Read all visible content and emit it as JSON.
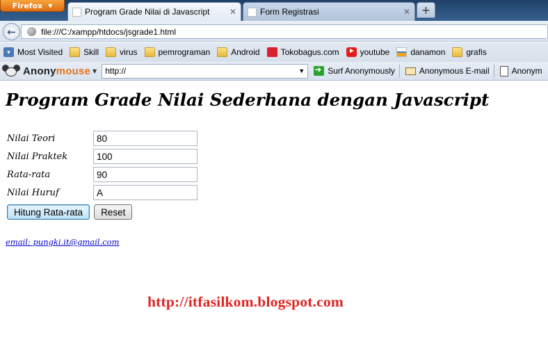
{
  "browser": {
    "menu_button": "Firefox",
    "tabs": [
      {
        "title": "Program Grade Nilai di Javascript",
        "active": true
      },
      {
        "title": "Form Registrasi",
        "active": false
      }
    ],
    "new_tab_label": "+",
    "close_glyph": "✕",
    "url": "file:///C:/xampp/htdocs/jsgrade1.html"
  },
  "bookmarks": [
    {
      "label": "Most Visited",
      "icon": "most-visited-icon"
    },
    {
      "label": "Skill",
      "icon": "folder-icon"
    },
    {
      "label": "virus",
      "icon": "folder-icon"
    },
    {
      "label": "pemrograman",
      "icon": "folder-icon"
    },
    {
      "label": "Android",
      "icon": "folder-icon"
    },
    {
      "label": "Tokobagus.com",
      "icon": "tokobagus-icon"
    },
    {
      "label": "youtube",
      "icon": "youtube-icon"
    },
    {
      "label": "danamon",
      "icon": "danamon-icon"
    },
    {
      "label": "grafis",
      "icon": "folder-icon"
    }
  ],
  "anonymouse": {
    "brand_prefix": "Anony",
    "brand_suffix": "mouse",
    "url_value": "http://",
    "surf_label": "Surf Anonymously",
    "email_label": "Anonymous E-mail",
    "extra_label": "Anonym"
  },
  "page": {
    "title": "Program Grade Nilai Sederhana dengan Javascript",
    "form": [
      {
        "label": "Nilai Teori",
        "value": "80"
      },
      {
        "label": "Nilai Praktek",
        "value": "100"
      },
      {
        "label": "Rata-rata",
        "value": "90"
      },
      {
        "label": "Nilai Huruf",
        "value": "A"
      }
    ],
    "buttons": {
      "calculate": "Hitung Rata-rata",
      "reset": "Reset"
    },
    "email": "email: pungki.it@gmail.com",
    "blog_url": "http://itfasilkom.blogspot.com"
  },
  "colors": {
    "blog_url": "#e02424",
    "link": "#0000cc",
    "firefox_button": "#e8821c"
  }
}
